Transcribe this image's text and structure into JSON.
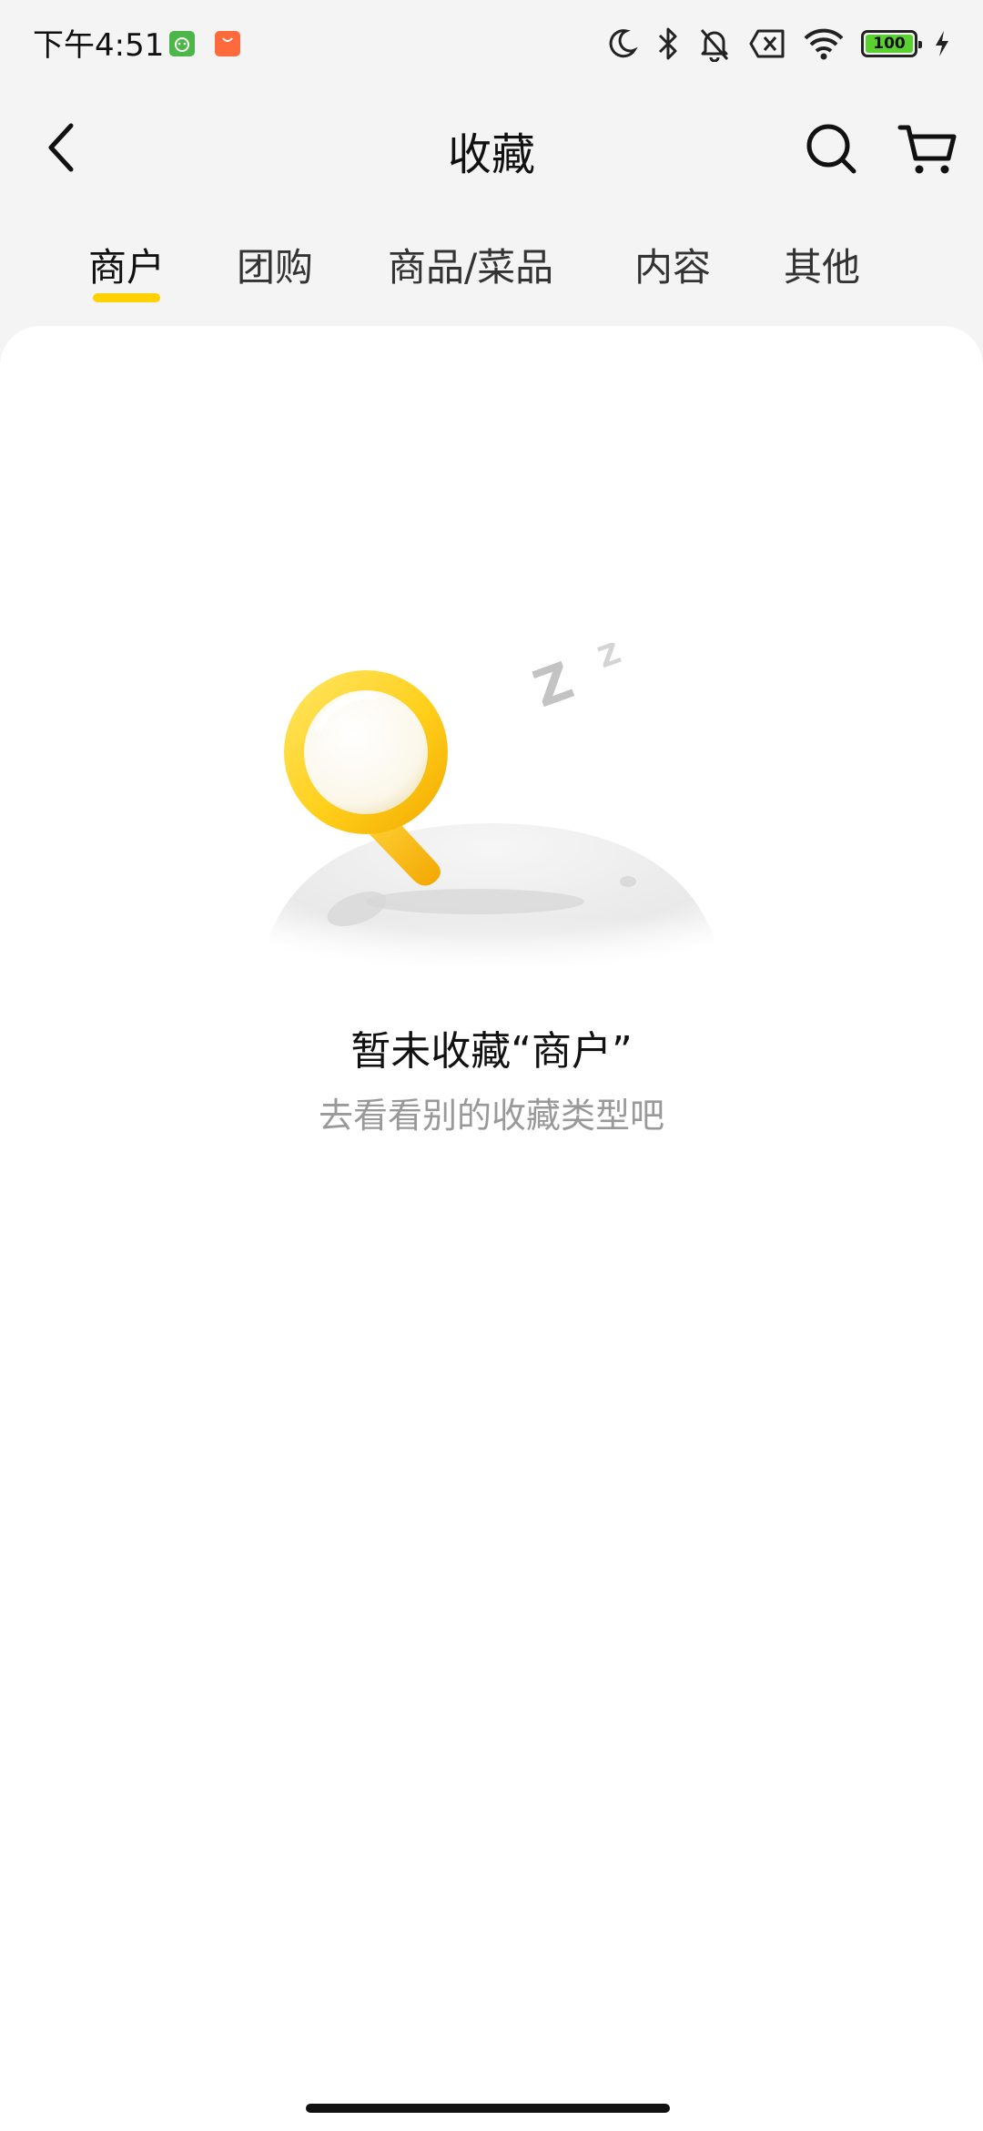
{
  "status_bar": {
    "time": "下午4:51",
    "battery_level": "100",
    "icons": [
      "app-android-icon",
      "app-shopping-icon",
      "moon-icon",
      "bluetooth-icon",
      "bell-muted-icon",
      "sim-off-icon",
      "wifi-icon",
      "battery-icon",
      "charging-icon"
    ]
  },
  "header": {
    "title": "收藏",
    "icons": [
      "back-chevron-icon",
      "search-icon",
      "cart-icon"
    ]
  },
  "tabs": [
    {
      "label": "商户",
      "active": true
    },
    {
      "label": "团购",
      "active": false
    },
    {
      "label": "商品/菜品",
      "active": false
    },
    {
      "label": "内容",
      "active": false
    },
    {
      "label": "其他",
      "active": false
    }
  ],
  "empty_state": {
    "title": "暂未收藏“商户”",
    "subtitle": "去看看别的收藏类型吧",
    "illustration": "sleeping-magnifier-icon"
  },
  "colors": {
    "accent": "#ffd100",
    "background": "#f4f4f4",
    "card": "#ffffff",
    "subtitle_text": "#999999"
  }
}
